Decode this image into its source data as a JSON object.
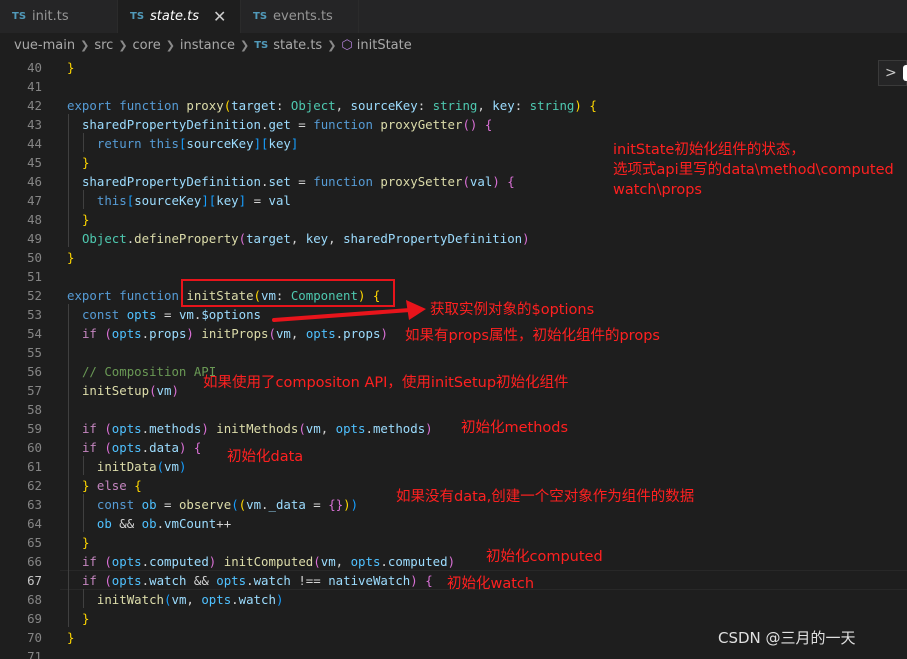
{
  "tabs": [
    {
      "icon": "TS",
      "label": "init.ts",
      "active": false
    },
    {
      "icon": "TS",
      "label": "state.ts",
      "active": true,
      "close": "✕"
    },
    {
      "icon": "TS",
      "label": "events.ts",
      "active": false
    }
  ],
  "breadcrumb": {
    "items": [
      "vue-main",
      "src",
      "core",
      "instance",
      "state.ts",
      "initState"
    ],
    "file_icon": "TS"
  },
  "side_button_glyph": ">",
  "line_numbers": [
    "40",
    "41",
    "42",
    "43",
    "44",
    "45",
    "46",
    "47",
    "48",
    "49",
    "50",
    "51",
    "52",
    "53",
    "54",
    "55",
    "56",
    "57",
    "58",
    "59",
    "60",
    "61",
    "62",
    "63",
    "64",
    "65",
    "66",
    "67",
    "68",
    "69",
    "70",
    "71"
  ],
  "active_line": "67",
  "code": {
    "l40": "}",
    "l42": "export function proxy(target: Object, sourceKey: string, key: string) {",
    "l43": "sharedPropertyDefinition.get = function proxyGetter() {",
    "l44": "return this[sourceKey][key]",
    "l45": "}",
    "l46": "sharedPropertyDefinition.set = function proxySetter(val) {",
    "l47": "this[sourceKey][key] = val",
    "l48": "}",
    "l49": "Object.defineProperty(target, key, sharedPropertyDefinition)",
    "l50": "}",
    "l52": "export function initState(vm: Component) {",
    "l53": "const opts = vm.$options",
    "l54": "if (opts.props) initProps(vm, opts.props)",
    "l56": "// Composition API",
    "l57": "initSetup(vm)",
    "l59": "if (opts.methods) initMethods(vm, opts.methods)",
    "l60": "if (opts.data) {",
    "l61": "initData(vm)",
    "l62": "} else {",
    "l63": "const ob = observe((vm._data = {}))",
    "l64": "ob && ob.vmCount++",
    "l65": "}",
    "l66": "if (opts.computed) initComputed(vm, opts.computed)",
    "l67": "if (opts.watch && opts.watch !== nativeWatch) {",
    "l68": "initWatch(vm, opts.watch)",
    "l69": "}",
    "l70": "}"
  },
  "annotations": {
    "summary_line1": "initState初始化组件的状态，",
    "summary_line2": "选项式api里写的data\\method\\computed",
    "summary_line3": "watch\\props",
    "options": "获取实例对象的$options",
    "props": "如果有props属性，初始化组件的props",
    "setup": "如果使用了compositon API，使用initSetup初始化组件",
    "methods": "初始化methods",
    "data": "初始化data",
    "empty_data": "如果没有data,创建一个空对象作为组件的数据",
    "computed": "初始化computed",
    "watch": "初始化watch"
  },
  "colors": {
    "annotation": "#ff2020",
    "keyword": "#569cd6",
    "control": "#c586c0",
    "function": "#dcdcaa",
    "variable": "#9cdcfe",
    "type": "#4ec9b0",
    "comment": "#6a9955"
  },
  "watermark": "CSDN @三月的一天"
}
